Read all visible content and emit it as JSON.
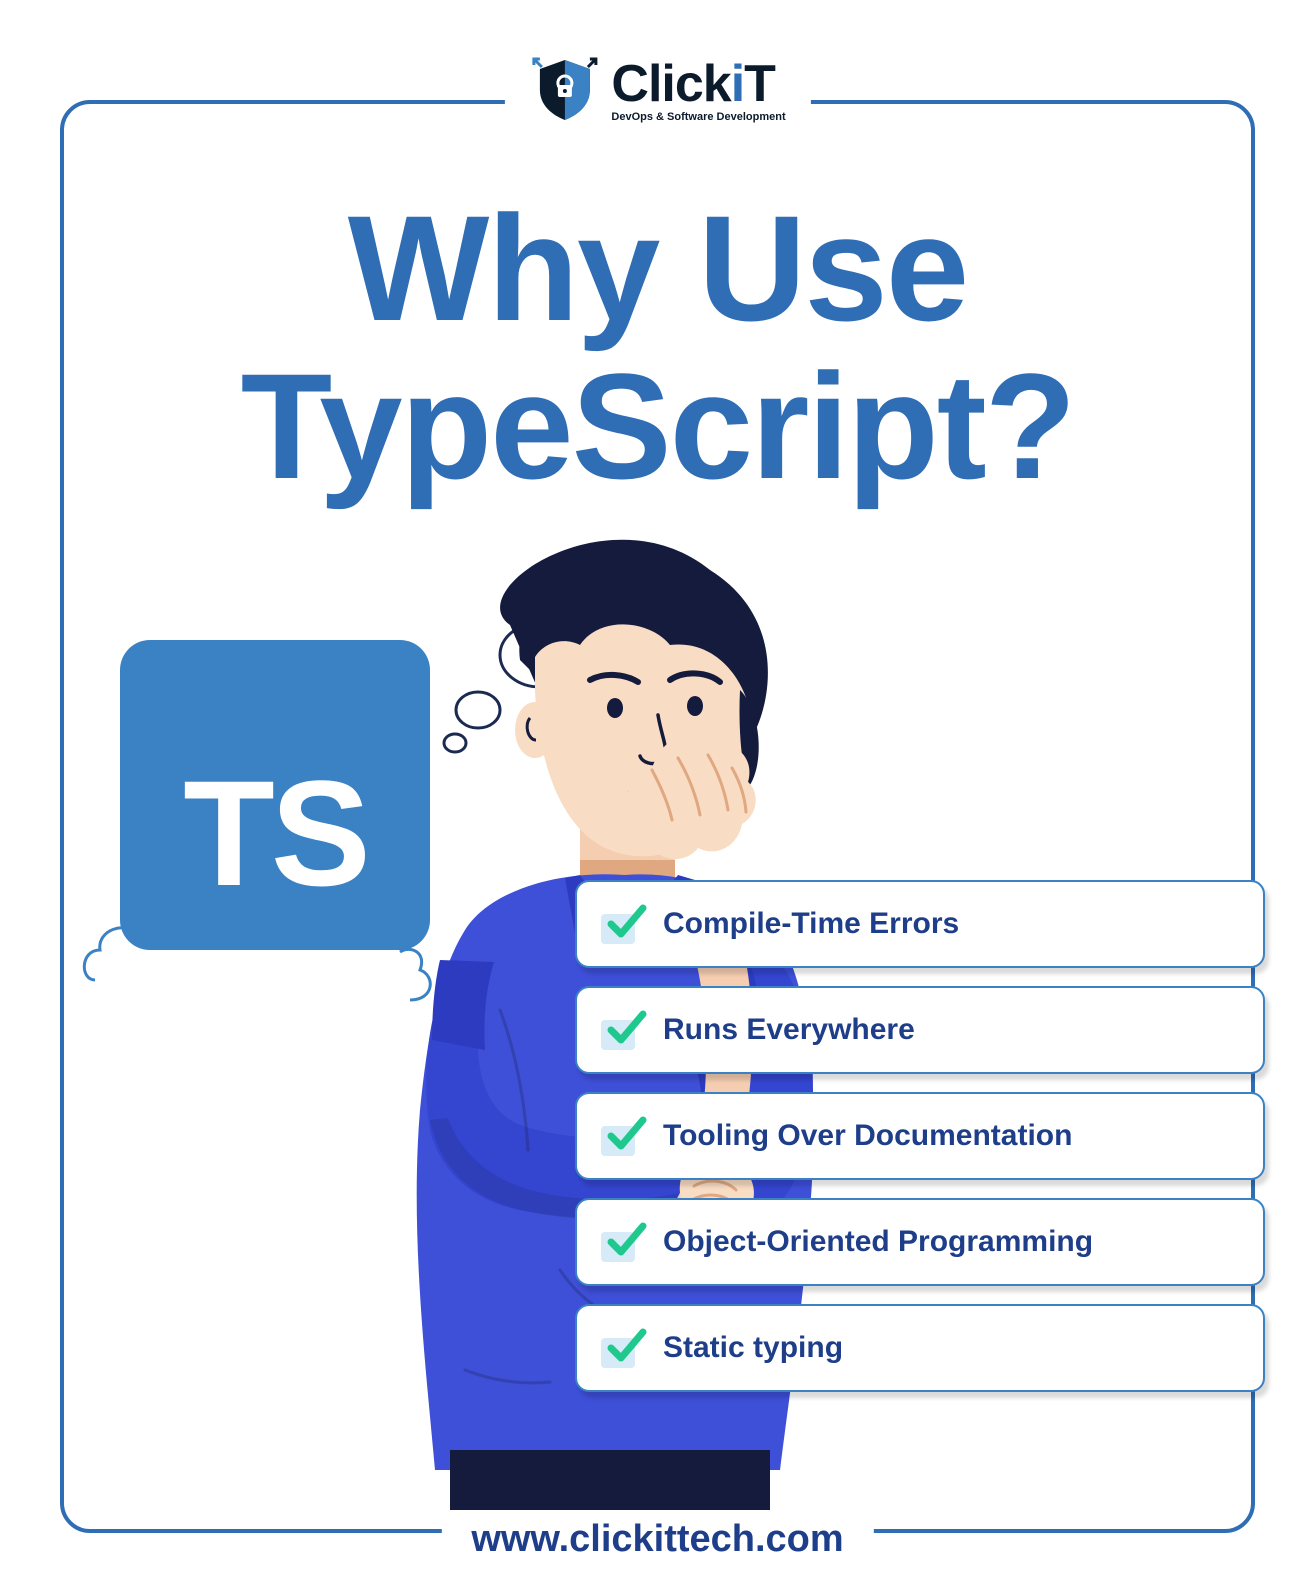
{
  "logo": {
    "name_part1": "Click",
    "name_part2": "i",
    "name_part3": "T",
    "tagline": "DevOps & Software Development"
  },
  "title": {
    "line1": "Why Use",
    "line2": "TypeScript?"
  },
  "ts_logo_text": "TS",
  "benefits": [
    {
      "label": "Compile-Time Errors"
    },
    {
      "label": "Runs Everywhere"
    },
    {
      "label": "Tooling Over Documentation"
    },
    {
      "label": "Object-Oriented Programming"
    },
    {
      "label": "Static typing"
    }
  ],
  "footer": {
    "url": "www.clickittech.com"
  }
}
